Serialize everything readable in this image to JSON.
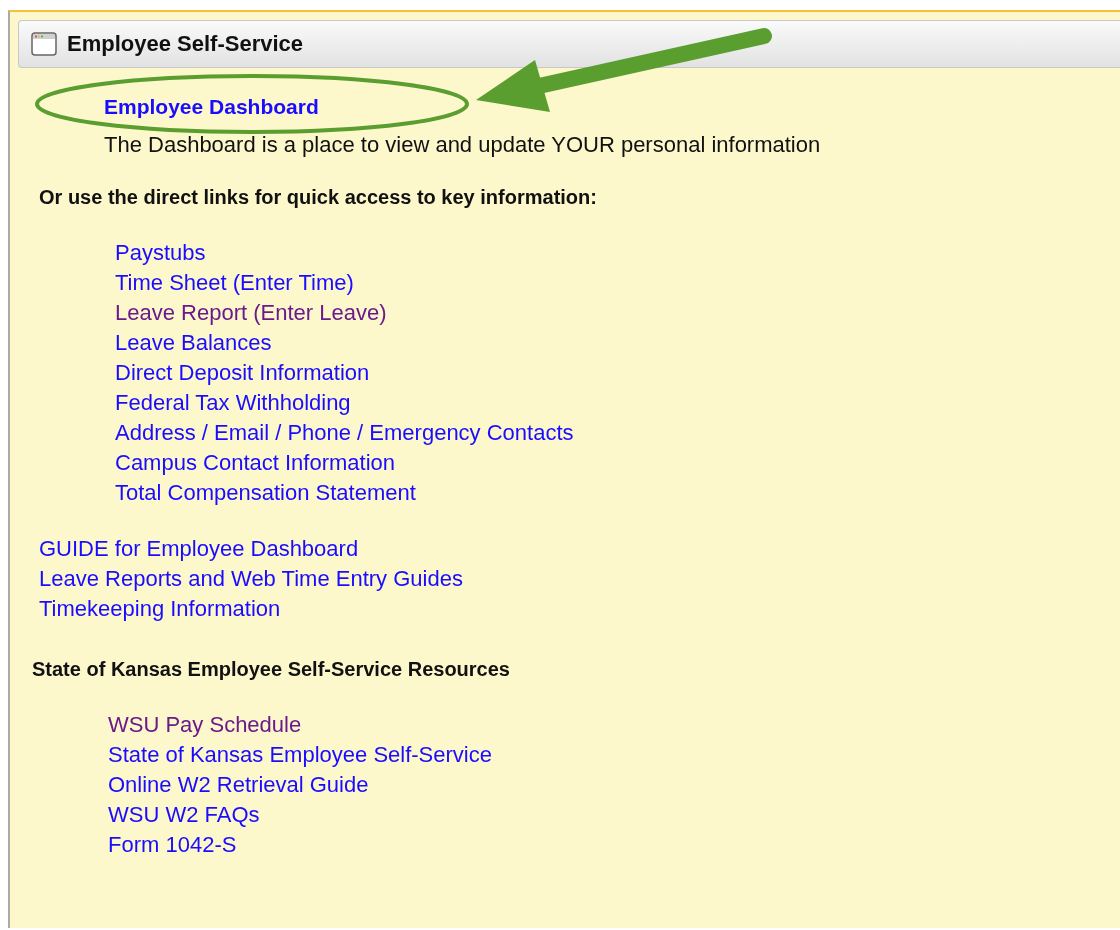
{
  "panel": {
    "title": "Employee Self-Service"
  },
  "dashboard": {
    "link": {
      "label": "Employee Dashboard",
      "visited": false
    },
    "description": "The Dashboard is a place to view and update YOUR personal information"
  },
  "direct_links": {
    "heading": "Or use the direct links for quick access to key information:",
    "links": [
      {
        "label": "Paystubs",
        "visited": false
      },
      {
        "label": "Time Sheet (Enter Time)",
        "visited": false
      },
      {
        "label": "Leave Report (Enter Leave)",
        "visited": true
      },
      {
        "label": "Leave Balances",
        "visited": false
      },
      {
        "label": "Direct Deposit Information",
        "visited": false
      },
      {
        "label": "Federal Tax Withholding",
        "visited": false
      },
      {
        "label": "Address / Email / Phone / Emergency Contacts",
        "visited": false
      },
      {
        "label": "Campus Contact Information",
        "visited": false
      },
      {
        "label": "Total Compensation Statement",
        "visited": false
      }
    ]
  },
  "guide_links": [
    {
      "label": "GUIDE for Employee Dashboard",
      "visited": false
    },
    {
      "label": "Leave Reports and Web Time Entry Guides",
      "visited": false
    },
    {
      "label": "Timekeeping Information",
      "visited": false
    }
  ],
  "resources": {
    "heading": "State of Kansas Employee Self-Service Resources",
    "links": [
      {
        "label": "WSU Pay Schedule",
        "visited": true
      },
      {
        "label": "State of Kansas Employee Self-Service",
        "visited": false
      },
      {
        "label": "Online W2 Retrieval Guide",
        "visited": false
      },
      {
        "label": "WSU W2 FAQs",
        "visited": false
      },
      {
        "label": "Form 1042-S",
        "visited": false
      }
    ]
  }
}
